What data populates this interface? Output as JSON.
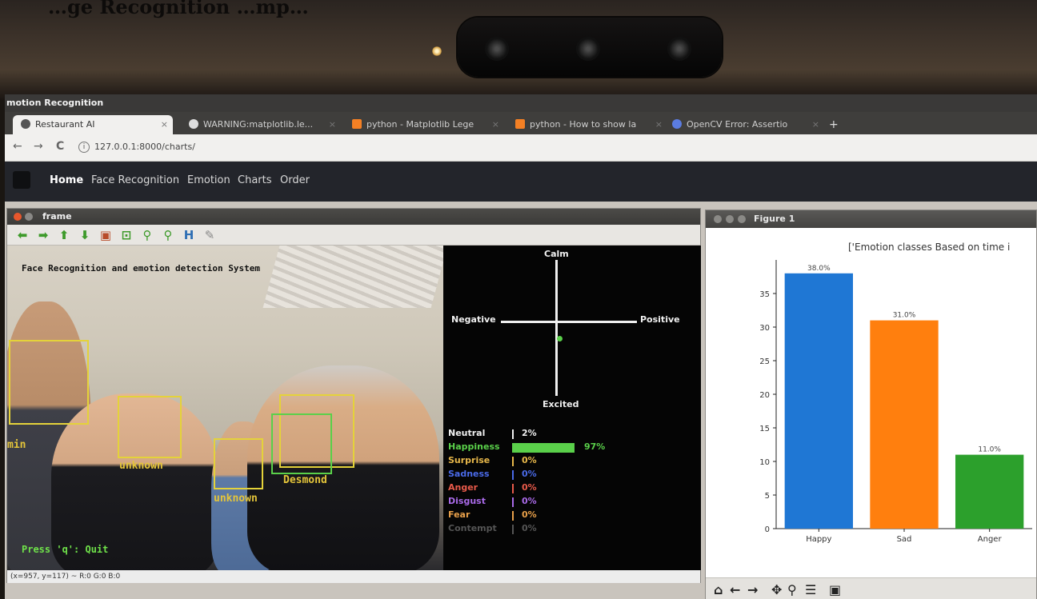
{
  "photo_caption": "…ge Recognition …mp…",
  "app_title": "motion Recognition",
  "tabs": [
    {
      "label": "Restaurant AI",
      "active": true
    },
    {
      "label": "WARNING:matplotlib.le..."
    },
    {
      "label": "python - Matplotlib Lege"
    },
    {
      "label": "python - How to show la"
    },
    {
      "label": "OpenCV Error: Assertio"
    }
  ],
  "new_tab": "+",
  "address": {
    "url": "127.0.0.1:8000/charts/",
    "back": "←",
    "forward": "→",
    "reload": "C"
  },
  "site_nav": {
    "items": [
      "Home",
      "Face Recognition",
      "Emotion",
      "Charts",
      "Order"
    ],
    "active": "Home"
  },
  "frame_window": {
    "title": "frame",
    "overlay_title": "Face Recognition and emotion detection System",
    "faces": [
      "min",
      "unknown",
      "unknown",
      "Desmond"
    ],
    "quit_hint": "Press 'q': Quit",
    "status": "(x=957, y=117) ~ R:0 G:0 B:0",
    "axes": {
      "top": "Calm",
      "left": "Negative",
      "right": "Positive",
      "bottom": "Excited"
    },
    "emotions": [
      {
        "name": "Neutral",
        "pct": "2%",
        "value": 0.02,
        "color": "#f0f0f0"
      },
      {
        "name": "Happiness",
        "pct": "97%",
        "value": 0.97,
        "color": "#5ad04a"
      },
      {
        "name": "Surprise",
        "pct": "0%",
        "value": 0.0,
        "color": "#e8b84a"
      },
      {
        "name": "Sadness",
        "pct": "0%",
        "value": 0.0,
        "color": "#4a6ae8"
      },
      {
        "name": "Anger",
        "pct": "0%",
        "value": 0.0,
        "color": "#e85a4a"
      },
      {
        "name": "Disgust",
        "pct": "0%",
        "value": 0.0,
        "color": "#a96ae8"
      },
      {
        "name": "Fear",
        "pct": "0%",
        "value": 0.0,
        "color": "#e8a04a"
      },
      {
        "name": "Contempt",
        "pct": "0%",
        "value": 0.0,
        "color": "#555555"
      }
    ]
  },
  "figure_window": {
    "title": "Figure 1"
  },
  "chart_data": {
    "type": "bar",
    "title": "['Emotion classes Based on time i",
    "categories": [
      "Happy",
      "Sad",
      "Anger"
    ],
    "values": [
      38.0,
      31.0,
      11.0
    ],
    "value_labels": [
      "38.0%",
      "31.0%",
      "11.0%"
    ],
    "colors": [
      "#1f77d4",
      "#ff7f0e",
      "#2ca02c"
    ],
    "yticks": [
      "0",
      "5",
      "10",
      "15",
      "20",
      "25",
      "30",
      "35"
    ],
    "ylim": [
      0,
      40
    ]
  }
}
